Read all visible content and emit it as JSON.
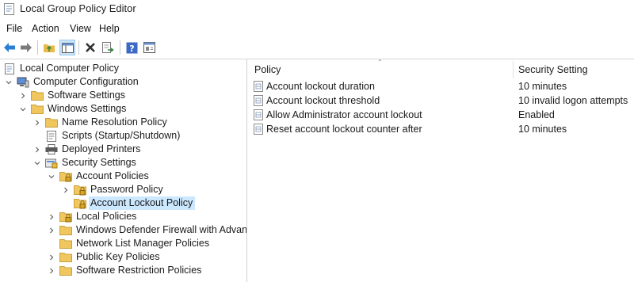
{
  "window": {
    "title": "Local Group Policy Editor"
  },
  "menu": [
    "File",
    "Action",
    "View",
    "Help"
  ],
  "toolbar": [
    {
      "icon": "back-arrow-icon"
    },
    {
      "icon": "forward-arrow-icon"
    },
    {
      "icon": "up-folder-icon"
    },
    {
      "icon": "show-hide-tree-icon"
    },
    {
      "icon": "delete-icon"
    },
    {
      "icon": "export-list-icon"
    },
    {
      "icon": "help-icon"
    },
    {
      "icon": "properties-icon"
    }
  ],
  "tree": [
    {
      "label": "Local Computer Policy",
      "icon": "policy-doc-icon",
      "expander": ""
    },
    {
      "label": "Computer Configuration",
      "icon": "computer-icon",
      "expander": "expanded"
    },
    {
      "label": "Software Settings",
      "icon": "folder-icon",
      "expander": "collapsed"
    },
    {
      "label": "Windows Settings",
      "icon": "folder-icon",
      "expander": "expanded"
    },
    {
      "label": "Name Resolution Policy",
      "icon": "folder-icon",
      "expander": "collapsed"
    },
    {
      "label": "Scripts (Startup/Shutdown)",
      "icon": "script-icon",
      "expander": ""
    },
    {
      "label": "Deployed Printers",
      "icon": "printer-icon",
      "expander": "collapsed"
    },
    {
      "label": "Security Settings",
      "icon": "security-icon",
      "expander": "expanded"
    },
    {
      "label": "Account Policies",
      "icon": "lock-folder-icon",
      "expander": "expanded"
    },
    {
      "label": "Password Policy",
      "icon": "lock-folder-icon",
      "expander": "collapsed"
    },
    {
      "label": "Account Lockout Policy",
      "icon": "lock-folder-icon",
      "expander": "",
      "selected": true
    },
    {
      "label": "Local Policies",
      "icon": "lock-folder-icon",
      "expander": "collapsed"
    },
    {
      "label": "Windows Defender Firewall with Advanced",
      "icon": "folder-icon",
      "expander": "collapsed"
    },
    {
      "label": "Network List Manager Policies",
      "icon": "folder-icon",
      "expander": ""
    },
    {
      "label": "Public Key Policies",
      "icon": "folder-icon",
      "expander": "collapsed"
    },
    {
      "label": "Software Restriction Policies",
      "icon": "folder-icon",
      "expander": "collapsed"
    }
  ],
  "list": {
    "columns": [
      "Policy",
      "Security Setting"
    ],
    "rows": [
      {
        "policy": "Account lockout duration",
        "setting": "10 minutes"
      },
      {
        "policy": "Account lockout threshold",
        "setting": "10 invalid logon attempts"
      },
      {
        "policy": "Allow Administrator account lockout",
        "setting": "Enabled"
      },
      {
        "policy": "Reset account lockout counter after",
        "setting": "10 minutes"
      }
    ]
  },
  "colors": {
    "selection": "#cce8ff",
    "folder": "#f0c75e",
    "accent": "#0078d4"
  }
}
